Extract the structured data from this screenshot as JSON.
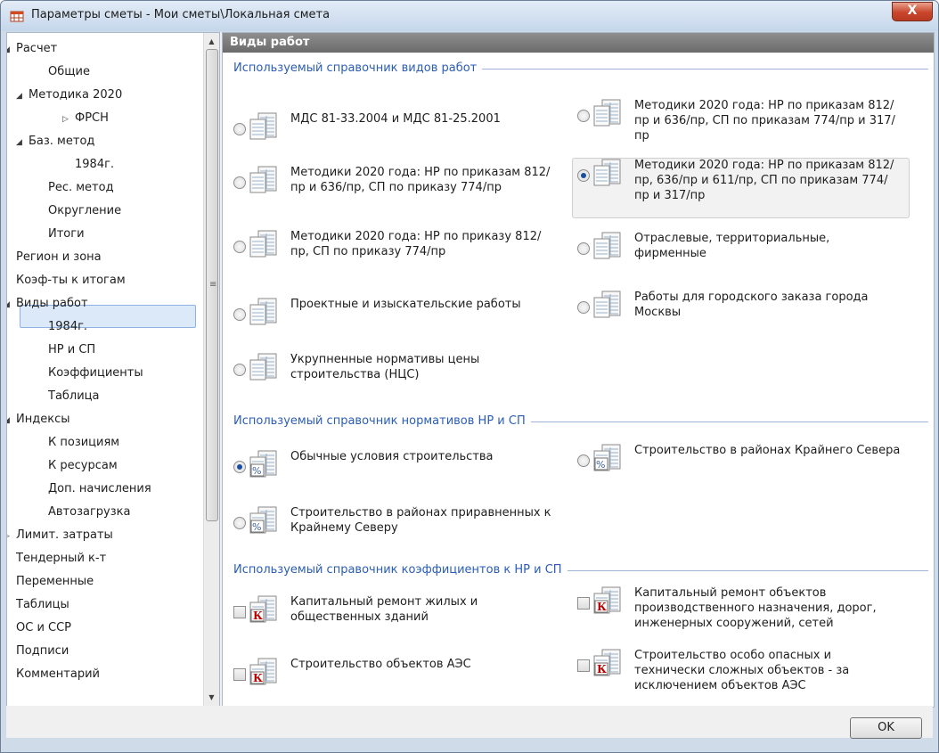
{
  "window": {
    "title": "Параметры сметы - Мои сметы\\Локальная смета",
    "close_label": "X"
  },
  "tree": {
    "items": [
      {
        "label": "Расчет",
        "arrow": "◢"
      },
      {
        "label": "Общие",
        "arrow": ""
      },
      {
        "label": "Методика 2020",
        "arrow": "◢"
      },
      {
        "label": "ФРСН",
        "arrow": "▷"
      },
      {
        "label": "Баз. метод",
        "arrow": "◢"
      },
      {
        "label": "1984г.",
        "arrow": ""
      },
      {
        "label": "Рес. метод",
        "arrow": ""
      },
      {
        "label": "Округление",
        "arrow": ""
      },
      {
        "label": "Итоги",
        "arrow": ""
      },
      {
        "label": "Регион и зона",
        "arrow": ""
      },
      {
        "label": "Коэф-ты к итогам",
        "arrow": ""
      },
      {
        "label": "Виды работ",
        "arrow": "◢"
      },
      {
        "label": "1984г.",
        "arrow": ""
      },
      {
        "label": "НР и СП",
        "arrow": ""
      },
      {
        "label": "Коэффициенты",
        "arrow": ""
      },
      {
        "label": "Таблица",
        "arrow": ""
      },
      {
        "label": "Индексы",
        "arrow": "◢"
      },
      {
        "label": "К позициям",
        "arrow": ""
      },
      {
        "label": "К ресурсам",
        "arrow": ""
      },
      {
        "label": "Доп. начисления",
        "arrow": ""
      },
      {
        "label": "Автозагрузка",
        "arrow": ""
      },
      {
        "label": "Лимит. затраты",
        "arrow": "▷"
      },
      {
        "label": "Тендерный к-т",
        "arrow": ""
      },
      {
        "label": "Переменные",
        "arrow": ""
      },
      {
        "label": "Таблицы",
        "arrow": ""
      },
      {
        "label": "ОС и ССР",
        "arrow": ""
      },
      {
        "label": "Подписи",
        "arrow": ""
      },
      {
        "label": "Комментарий",
        "arrow": ""
      }
    ],
    "selected": "Виды работ"
  },
  "content": {
    "header": "Виды работ",
    "sections": {
      "work_types": "Используемый справочник видов работ",
      "norms": "Используемый справочник нормативов НР и СП",
      "coefs": "Используемый справочник коэффициентов к НР и СП"
    },
    "work_options": [
      {
        "label": "МДС 81-33.2004 и МДС 81-25.2001",
        "checked": false
      },
      {
        "label": "Методики 2020 года: НР по приказам 812/пр и 636/пр, СП по приказам 774/пр и 317/пр",
        "checked": false
      },
      {
        "label": "Методики 2020 года: НР по приказам 812/пр и 636/пр, СП по приказу 774/пр",
        "checked": false
      },
      {
        "label": "Методики 2020 года: НР по приказам 812/пр, 636/пр и 611/пр, СП по приказам 774/пр и 317/пр",
        "checked": true
      },
      {
        "label": "Методики 2020 года: НР по приказу 812/пр, СП по приказу 774/пр",
        "checked": false
      },
      {
        "label": "Отраслевые, территориальные, фирменные",
        "checked": false
      },
      {
        "label": "Проектные и изыскательские работы",
        "checked": false
      },
      {
        "label": "Работы для городского заказа города Москвы",
        "checked": false
      },
      {
        "label": "Укрупненные нормативы цены строительства (НЦС)",
        "checked": false
      }
    ],
    "norm_options": [
      {
        "label": "Обычные условия строительства",
        "checked": true
      },
      {
        "label": "Строительство в районах Крайнего Севера",
        "checked": false
      },
      {
        "label": "Строительство в районах приравненных к Крайнему Северу",
        "checked": false
      }
    ],
    "coef_options": [
      {
        "label": "Капитальный ремонт жилых и общественных зданий",
        "checked": false
      },
      {
        "label": "Капитальный ремонт объектов производственного назначения, дорог, инженерных сооружений, сетей",
        "checked": false
      },
      {
        "label": "Строительство объектов АЭС",
        "checked": false
      },
      {
        "label": "Строительство особо опасных и технически сложных объектов - за исключением объектов АЭС",
        "checked": false
      }
    ]
  },
  "footer": {
    "ok_label": "OK"
  },
  "colors": {
    "section_title": "#2b5db7",
    "radio_dot": "#1a4f9e",
    "coef_icon": "#c00000"
  },
  "icons": {
    "doc": "table-document-icon",
    "percent": "percent-document-icon",
    "coef": "coefficient-document-icon"
  }
}
